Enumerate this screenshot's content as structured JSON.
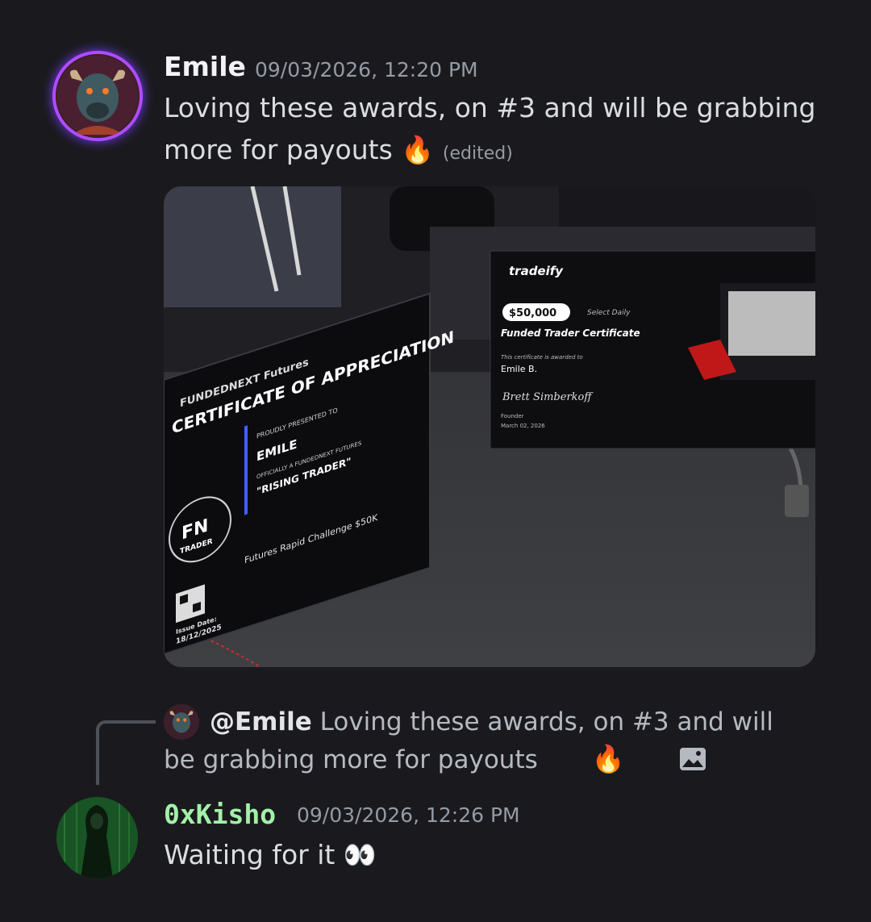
{
  "messages": [
    {
      "author": "Emile",
      "timestamp": "09/03/2026, 12:20 PM",
      "text_line1": "Loving these awards, on #3 and will be grabbing",
      "text_line2": "more for payouts",
      "emoji": "🔥",
      "edited_label": "(edited)",
      "author_color": "#f2f3f5",
      "avatar_icon": "bull-avatar-icon",
      "attachment": {
        "left_plaque": {
          "brand": "FUNDEDNEXT",
          "brand_tag": "Futures",
          "title": "CERTIFICATE OF APPRECIATION",
          "presented": "PROUDLY PRESENTED TO",
          "name": "EMILE",
          "officially": "OFFICIALLY A FUNDEDNEXT FUTURES",
          "rank": "\"RISING TRADER\"",
          "badge": "FN",
          "badge_sub": "TRADER",
          "challenge": "Futures Rapid Challenge $50K",
          "issue_label": "Issue Date:",
          "issue_date": "18/12/2025"
        },
        "right_plaque": {
          "brand": "tradeify",
          "amount": "$50,000",
          "plan": "Select Daily",
          "title": "Funded Trader Certificate",
          "awarded": "This certificate is awarded to",
          "name": "Emile B.",
          "signature": "Brett Simberkoff",
          "role": "Founder",
          "date": "March 02, 2026"
        }
      }
    },
    {
      "author": "0xKisho",
      "timestamp": "09/03/2026, 12:26 PM",
      "text": "Waiting for it",
      "emoji": "👀",
      "author_color": "#a3f0a8",
      "avatar_icon": "hooded-figure-avatar-icon",
      "reply": {
        "mention": "@Emile",
        "text_line1": "Loving these awards, on #3 and will be",
        "text_line2": "grabbing more for payouts",
        "emoji": "🔥",
        "icon": "image-icon"
      }
    }
  ]
}
